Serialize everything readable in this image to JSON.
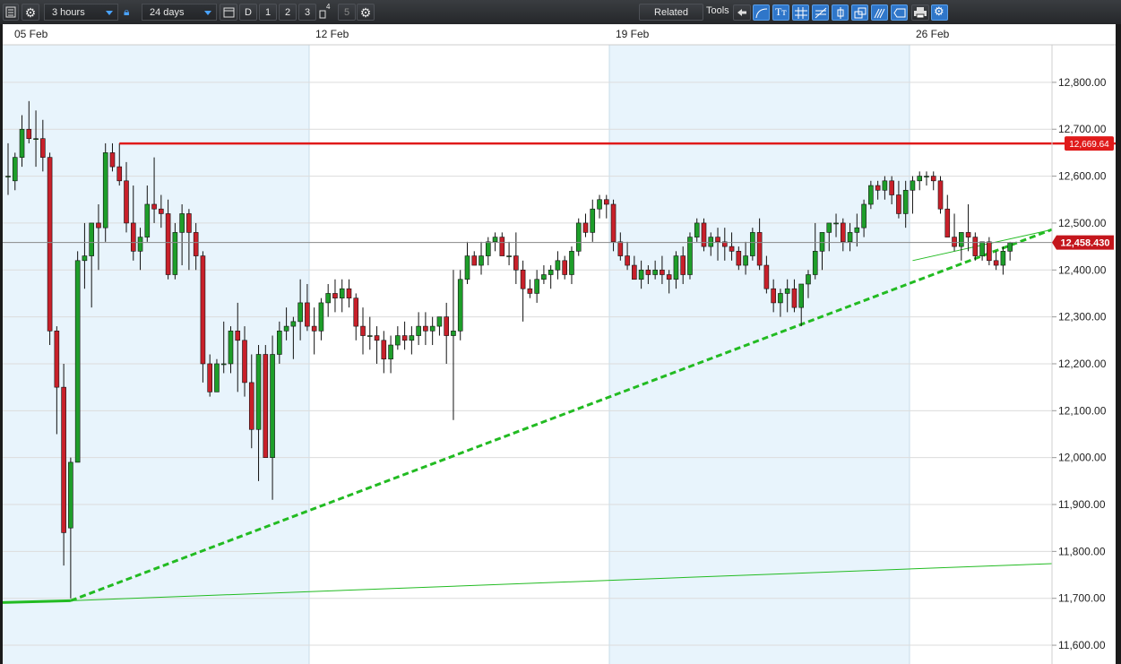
{
  "toolbar": {
    "interval": "3 hours",
    "range": "24 days",
    "period_d": "D",
    "period_1": "1",
    "period_2": "2",
    "period_3": "3",
    "period_4": "4",
    "period_5": "5",
    "related": "Related",
    "tools": "Tools",
    "tool_text": "Tт"
  },
  "colors": {
    "up": "#1e9e2a",
    "down": "#c8202a",
    "resistance": "#e01a1a",
    "trend": "#22bb22",
    "band": "#e8f4fc"
  },
  "chart_data": {
    "type": "candlestick",
    "x_labels": [
      "05 Feb",
      "12 Feb",
      "19 Feb",
      "26 Feb"
    ],
    "y_ticks": [
      "12,800.00",
      "12,700.00",
      "12,600.00",
      "12,500.00",
      "12,400.00",
      "12,300.00",
      "12,200.00",
      "12,100.00",
      "12,000.00",
      "11,900.00",
      "11,800.00",
      "11,700.00",
      "11,600.00"
    ],
    "ylim": [
      11560,
      12880
    ],
    "resistance_label": "12,669.64",
    "resistance": 12669.64,
    "last_price_label": "12,458.430",
    "last_price": 12458.43,
    "trendline_dashed": [
      [
        9,
        11695
      ],
      [
        150,
        12486
      ]
    ],
    "trendline_solid": [
      [
        9,
        11695
      ],
      [
        150,
        11774
      ]
    ],
    "ohlc": [
      [
        12600,
        12670,
        12560,
        12600
      ],
      [
        12590,
        12650,
        12570,
        12640
      ],
      [
        12640,
        12730,
        12620,
        12700
      ],
      [
        12700,
        12760,
        12670,
        12680
      ],
      [
        12680,
        12740,
        12620,
        12680
      ],
      [
        12680,
        12720,
        12610,
        12640
      ],
      [
        12640,
        12650,
        12240,
        12270
      ],
      [
        12270,
        12280,
        12050,
        12150
      ],
      [
        12150,
        12200,
        11770,
        11840
      ],
      [
        11850,
        12000,
        11700,
        11990
      ],
      [
        11990,
        12440,
        11990,
        12420
      ],
      [
        12420,
        12500,
        12360,
        12430
      ],
      [
        12430,
        12500,
        12320,
        12500
      ],
      [
        12500,
        12540,
        12400,
        12490
      ],
      [
        12490,
        12670,
        12460,
        12650
      ],
      [
        12650,
        12670,
        12610,
        12620
      ],
      [
        12620,
        12670,
        12580,
        12590
      ],
      [
        12590,
        12630,
        12480,
        12500
      ],
      [
        12500,
        12580,
        12420,
        12440
      ],
      [
        12440,
        12490,
        12400,
        12470
      ],
      [
        12470,
        12580,
        12460,
        12540
      ],
      [
        12540,
        12640,
        12500,
        12530
      ],
      [
        12530,
        12560,
        12490,
        12520
      ],
      [
        12520,
        12550,
        12380,
        12390
      ],
      [
        12390,
        12500,
        12380,
        12480
      ],
      [
        12480,
        12540,
        12410,
        12520
      ],
      [
        12520,
        12530,
        12400,
        12480
      ],
      [
        12480,
        12500,
        12400,
        12430
      ],
      [
        12430,
        12440,
        12160,
        12200
      ],
      [
        12200,
        12220,
        12130,
        12140
      ],
      [
        12140,
        12210,
        12140,
        12200
      ],
      [
        12200,
        12290,
        12180,
        12200
      ],
      [
        12200,
        12280,
        12180,
        12270
      ],
      [
        12270,
        12330,
        12140,
        12250
      ],
      [
        12250,
        12280,
        12130,
        12160
      ],
      [
        12160,
        12220,
        12020,
        12060
      ],
      [
        12060,
        12240,
        11950,
        12220
      ],
      [
        12220,
        12240,
        12030,
        12000
      ],
      [
        12000,
        12260,
        11910,
        12220
      ],
      [
        12220,
        12290,
        12200,
        12270
      ],
      [
        12270,
        12320,
        12250,
        12280
      ],
      [
        12280,
        12300,
        12210,
        12290
      ],
      [
        12290,
        12380,
        12250,
        12330
      ],
      [
        12330,
        12370,
        12270,
        12280
      ],
      [
        12280,
        12320,
        12220,
        12270
      ],
      [
        12270,
        12340,
        12250,
        12330
      ],
      [
        12330,
        12370,
        12300,
        12350
      ],
      [
        12350,
        12380,
        12310,
        12340
      ],
      [
        12340,
        12380,
        12310,
        12360
      ],
      [
        12360,
        12380,
        12320,
        12340
      ],
      [
        12340,
        12350,
        12250,
        12280
      ],
      [
        12280,
        12320,
        12220,
        12260
      ],
      [
        12260,
        12300,
        12230,
        12260
      ],
      [
        12260,
        12280,
        12200,
        12250
      ],
      [
        12250,
        12270,
        12180,
        12210
      ],
      [
        12210,
        12260,
        12180,
        12240
      ],
      [
        12240,
        12280,
        12230,
        12260
      ],
      [
        12260,
        12290,
        12230,
        12250
      ],
      [
        12250,
        12280,
        12220,
        12260
      ],
      [
        12260,
        12310,
        12240,
        12280
      ],
      [
        12280,
        12310,
        12240,
        12270
      ],
      [
        12270,
        12300,
        12240,
        12280
      ],
      [
        12280,
        12300,
        12260,
        12300
      ],
      [
        12300,
        12330,
        12200,
        12260
      ],
      [
        12260,
        12400,
        12080,
        12270
      ],
      [
        12270,
        12400,
        12250,
        12380
      ],
      [
        12380,
        12460,
        12370,
        12430
      ],
      [
        12430,
        12440,
        12410,
        12410
      ],
      [
        12410,
        12460,
        12390,
        12430
      ],
      [
        12430,
        12470,
        12410,
        12460
      ],
      [
        12460,
        12480,
        12440,
        12470
      ],
      [
        12470,
        12480,
        12430,
        12430
      ],
      [
        12430,
        12460,
        12410,
        12430
      ],
      [
        12430,
        12480,
        12370,
        12400
      ],
      [
        12400,
        12420,
        12290,
        12360
      ],
      [
        12360,
        12380,
        12340,
        12350
      ],
      [
        12350,
        12400,
        12330,
        12380
      ],
      [
        12380,
        12410,
        12370,
        12390
      ],
      [
        12390,
        12410,
        12360,
        12400
      ],
      [
        12400,
        12440,
        12380,
        12420
      ],
      [
        12420,
        12430,
        12380,
        12390
      ],
      [
        12390,
        12450,
        12370,
        12440
      ],
      [
        12440,
        12510,
        12430,
        12500
      ],
      [
        12500,
        12520,
        12470,
        12480
      ],
      [
        12480,
        12550,
        12460,
        12530
      ],
      [
        12530,
        12560,
        12510,
        12550
      ],
      [
        12550,
        12560,
        12510,
        12540
      ],
      [
        12540,
        12550,
        12440,
        12460
      ],
      [
        12460,
        12480,
        12420,
        12430
      ],
      [
        12430,
        12460,
        12400,
        12410
      ],
      [
        12410,
        12430,
        12380,
        12380
      ],
      [
        12380,
        12420,
        12360,
        12400
      ],
      [
        12400,
        12410,
        12370,
        12390
      ],
      [
        12390,
        12420,
        12380,
        12400
      ],
      [
        12400,
        12430,
        12370,
        12390
      ],
      [
        12390,
        12400,
        12350,
        12380
      ],
      [
        12380,
        12440,
        12360,
        12430
      ],
      [
        12430,
        12450,
        12370,
        12390
      ],
      [
        12390,
        12480,
        12380,
        12470
      ],
      [
        12470,
        12510,
        12460,
        12500
      ],
      [
        12500,
        12510,
        12440,
        12450
      ],
      [
        12450,
        12480,
        12430,
        12470
      ],
      [
        12470,
        12490,
        12420,
        12460
      ],
      [
        12460,
        12490,
        12420,
        12450
      ],
      [
        12450,
        12480,
        12420,
        12440
      ],
      [
        12440,
        12450,
        12400,
        12410
      ],
      [
        12410,
        12460,
        12390,
        12430
      ],
      [
        12430,
        12490,
        12420,
        12480
      ],
      [
        12480,
        12510,
        12400,
        12410
      ],
      [
        12410,
        12430,
        12350,
        12360
      ],
      [
        12360,
        12380,
        12310,
        12330
      ],
      [
        12330,
        12360,
        12300,
        12350
      ],
      [
        12350,
        12380,
        12310,
        12360
      ],
      [
        12360,
        12380,
        12310,
        12320
      ],
      [
        12320,
        12360,
        12280,
        12370
      ],
      [
        12370,
        12400,
        12340,
        12390
      ],
      [
        12390,
        12500,
        12380,
        12440
      ],
      [
        12440,
        12480,
        12400,
        12480
      ],
      [
        12480,
        12500,
        12440,
        12500
      ],
      [
        12500,
        12520,
        12470,
        12500
      ],
      [
        12500,
        12510,
        12440,
        12460
      ],
      [
        12460,
        12500,
        12440,
        12480
      ],
      [
        12480,
        12520,
        12450,
        12490
      ],
      [
        12490,
        12550,
        12470,
        12540
      ],
      [
        12540,
        12590,
        12530,
        12580
      ],
      [
        12580,
        12590,
        12550,
        12570
      ],
      [
        12570,
        12600,
        12550,
        12590
      ],
      [
        12590,
        12600,
        12540,
        12560
      ],
      [
        12560,
        12590,
        12510,
        12520
      ],
      [
        12520,
        12590,
        12490,
        12570
      ],
      [
        12570,
        12600,
        12520,
        12590
      ],
      [
        12590,
        12610,
        12570,
        12600
      ],
      [
        12600,
        12610,
        12580,
        12600
      ],
      [
        12600,
        12610,
        12570,
        12590
      ],
      [
        12590,
        12600,
        12520,
        12530
      ],
      [
        12530,
        12560,
        12470,
        12470
      ],
      [
        12470,
        12520,
        12440,
        12450
      ],
      [
        12450,
        12480,
        12420,
        12480
      ],
      [
        12480,
        12540,
        12440,
        12470
      ],
      [
        12470,
        12480,
        12420,
        12430
      ],
      [
        12430,
        12460,
        12420,
        12460
      ],
      [
        12460,
        12470,
        12410,
        12420
      ],
      [
        12420,
        12440,
        12400,
        12410
      ],
      [
        12410,
        12450,
        12390,
        12440
      ],
      [
        12440,
        12460,
        12420,
        12458
      ]
    ]
  }
}
